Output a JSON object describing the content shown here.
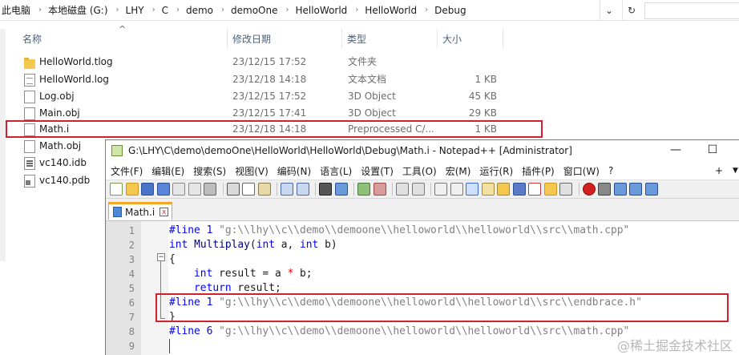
{
  "explorer": {
    "breadcrumbs": [
      "此电脑",
      "本地磁盘 (G:)",
      "LHY",
      "C",
      "demo",
      "demoOne",
      "HelloWorld",
      "HelloWorld",
      "Debug"
    ],
    "refresh_glyph": "↻",
    "columns": [
      "名称",
      "修改日期",
      "类型",
      "大小"
    ],
    "sort_glyph": "^",
    "files": [
      {
        "name": "HelloWorld.tlog",
        "date": "23/12/15 17:52",
        "type": "文件夹",
        "size": "",
        "icon": "folder-icon"
      },
      {
        "name": "HelloWorld.log",
        "date": "23/12/18 14:18",
        "type": "文本文档",
        "size": "1 KB",
        "icon": "text-file-icon"
      },
      {
        "name": "Log.obj",
        "date": "23/12/15 17:52",
        "type": "3D Object",
        "size": "45 KB",
        "icon": "file-icon"
      },
      {
        "name": "Main.obj",
        "date": "23/12/15 17:41",
        "type": "3D Object",
        "size": "29 KB",
        "icon": "file-icon"
      },
      {
        "name": "Math.i",
        "date": "23/12/18 14:18",
        "type": "Preprocessed C/...",
        "size": "1 KB",
        "icon": "file-icon"
      },
      {
        "name": "Math.obj",
        "date": "",
        "type": "",
        "size": "",
        "icon": "file-icon"
      },
      {
        "name": "vc140.idb",
        "date": "",
        "type": "",
        "size": "",
        "icon": "database-file-icon"
      },
      {
        "name": "vc140.pdb",
        "date": "",
        "type": "",
        "size": "",
        "icon": "pdb-file-icon"
      }
    ]
  },
  "notepad": {
    "title": "G:\\LHY\\C\\demo\\demoOne\\HelloWorld\\HelloWorld\\Debug\\Math.i - Notepad++ [Administrator]",
    "minimize_glyph": "—",
    "maximize_glyph": "☐",
    "menu": [
      "文件(F)",
      "编辑(E)",
      "搜索(S)",
      "视图(V)",
      "编码(N)",
      "语言(L)",
      "设置(T)",
      "工具(O)",
      "宏(M)",
      "运行(R)",
      "插件(P)",
      "窗口(W)",
      "?"
    ],
    "menu_plus": "+",
    "menu_down": "▼",
    "tab": {
      "label": "Math.i",
      "close_glyph": "x"
    },
    "fold_glyph": "−",
    "lines": [
      {
        "n": "1",
        "text": "#line 1 \"g:\\\\lhy\\\\c\\\\demo\\\\demoone\\\\helloworld\\\\helloworld\\\\src\\\\math.cpp\""
      },
      {
        "n": "2",
        "text": "int Multiplay(int a, int b)"
      },
      {
        "n": "3",
        "text": "{"
      },
      {
        "n": "4",
        "text": "    int result = a * b;"
      },
      {
        "n": "5",
        "text": "    return result;"
      },
      {
        "n": "6",
        "text": "#line 1 \"g:\\\\lhy\\\\c\\\\demo\\\\demoone\\\\helloworld\\\\helloworld\\\\src\\\\endbrace.h\""
      },
      {
        "n": "7",
        "text": "}"
      },
      {
        "n": "8",
        "text": "#line 6 \"g:\\\\lhy\\\\c\\\\demo\\\\demoone\\\\helloworld\\\\helloworld\\\\src\\\\math.cpp\""
      },
      {
        "n": "9",
        "text": ""
      }
    ]
  },
  "watermark": "@稀土掘金技术社区",
  "colors": {
    "highlight_box": "#d2202f",
    "tab_accent": "#f5a623",
    "keyword": "#0000ff",
    "string": "#808080",
    "operator": "#ff0000"
  }
}
